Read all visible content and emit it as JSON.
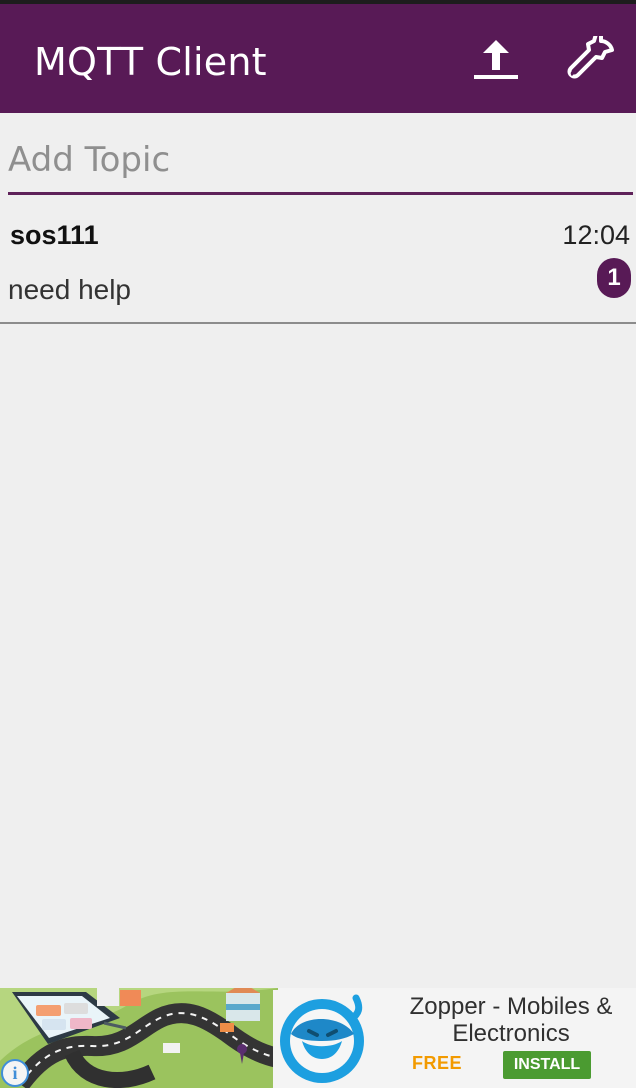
{
  "app": {
    "title": "MQTT Client",
    "accent_color": "#581a56",
    "icons": {
      "publish": "upload-icon",
      "settings": "wrench-icon"
    }
  },
  "topic_input": {
    "placeholder": "Add Topic",
    "value": ""
  },
  "topics": [
    {
      "name": "sos111",
      "time": "12:04",
      "message": "need help",
      "unread_count": "1"
    }
  ],
  "ad": {
    "title": "Zopper - Mobiles & Electronics",
    "price": "FREE",
    "install_label": "INSTALL",
    "info_icon": "info-icon",
    "colors": {
      "price": "#f29a00",
      "install": "#4b9b31",
      "info": "#3f8ed8"
    }
  }
}
